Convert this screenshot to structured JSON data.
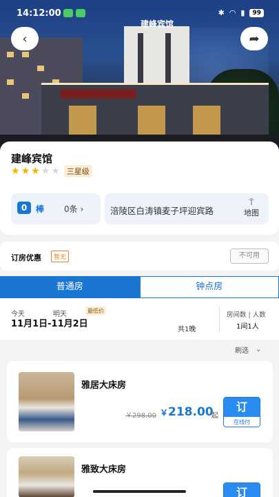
{
  "status_bar": {
    "time": "14:12:00",
    "battery": "99",
    "icons": [
      "bluetooth-icon",
      "wifi-icon",
      "signal-icon"
    ]
  },
  "hero": {
    "hotel_sign_text": "建峰宾馆",
    "icons": {
      "back": "chevron-left-icon",
      "share": "share-icon"
    }
  },
  "hotel": {
    "name": "建峰宾馆",
    "stars_filled": 3,
    "stars_total": 5,
    "star_label": "三星级",
    "score": "0",
    "score_word": "棒",
    "review_count": "0条",
    "address": "涪陵区白涛镇麦子坪迎宾路",
    "map_label": "地图"
  },
  "offer": {
    "label": "订房优惠",
    "badge": "暂无",
    "button": "不可用"
  },
  "tabs": [
    {
      "label": "普通房",
      "active": true
    },
    {
      "label": "钟点房",
      "active": false
    }
  ],
  "dates": {
    "today_label": "今天",
    "tomorrow_label": "明天",
    "lowest_badge": "最低价",
    "range": "11月1日-11月2日",
    "nights": "共1晚",
    "rooms_guests_label": "房间数 | 人数",
    "rooms_guests_value": "1间1人"
  },
  "filter_label": "刷选",
  "rooms": [
    {
      "name": "雅居大床房",
      "old_price": "￥298.00",
      "currency": "￥",
      "price": "218.00",
      "price_suffix": "起",
      "book_label": "订",
      "book_sub": "在线付"
    },
    {
      "name": "雅致大床房",
      "book_label": "订"
    }
  ],
  "colors": {
    "accent": "#1976d2",
    "star": "#f4b400",
    "offer_badge": "#e67e22"
  }
}
